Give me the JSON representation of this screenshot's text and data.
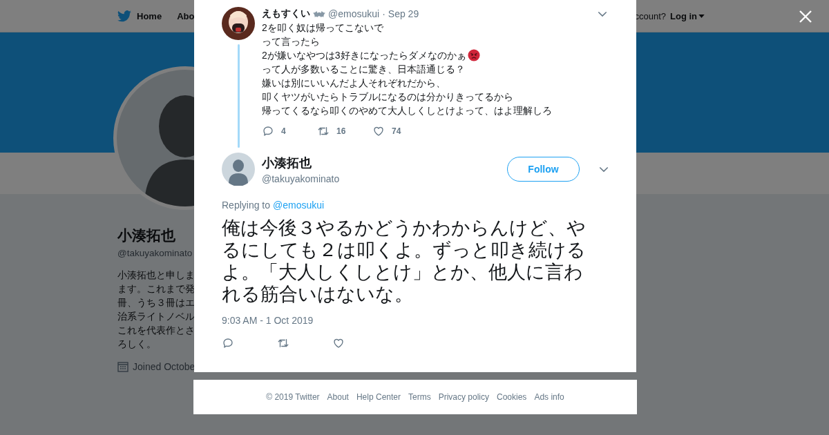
{
  "background_page": {
    "nav": {
      "items": [
        {
          "label": "Home"
        },
        {
          "label": "Abo"
        }
      ],
      "login_prompt": "ccount?",
      "login": "Log in"
    },
    "profile": {
      "name": "小湊拓也",
      "handle": "@takuyakominato",
      "bio_lines": [
        "小湊拓也と申しま",
        "ます。これまで発",
        "冊、うち３冊はエ",
        "治系ライトノベル",
        "これを代表作とさ",
        "ろしく。"
      ],
      "joined": "Joined Octobe"
    }
  },
  "modal": {
    "parent_tweet": {
      "name": "えもすくい",
      "handle": "@emosukui",
      "separator": "·",
      "date": "Sep 29",
      "lines": [
        {
          "text": "2を叩く奴は帰ってこないで",
          "emoji": false
        },
        {
          "text": "って言ったら",
          "emoji": false
        },
        {
          "text": "2が嫌いなやつは3好きになったらダメなのかぁ",
          "emoji": true
        },
        {
          "text": "って人が多数いることに驚き、日本語通じる？",
          "emoji": false
        },
        {
          "text": "嫌いは別にいいんだよ人それぞれだから、",
          "emoji": false
        },
        {
          "text": "叩くヤツがいたらトラブルになるのは分かりきってるから",
          "emoji": false
        },
        {
          "text": "帰ってくるなら叩くのやめて大人しくしとけよって、はよ理解しろ",
          "emoji": false
        }
      ],
      "replies": "4",
      "retweets": "16",
      "likes": "74"
    },
    "tweet": {
      "name": "小湊拓也",
      "handle": "@takuyakominato",
      "follow": "Follow",
      "replying_prefix": "Replying to",
      "replying_to": "@emosukui",
      "text": "俺は今後３やるかどうかわからんけど、やるにしても２は叩くよ。ずっと叩き続けるよ。「大人しくしとけ」とか、他人に言われる筋合いはないな。",
      "timestamp": "9:03 AM - 1 Oct 2019"
    }
  },
  "footer": {
    "links": [
      "© 2019 Twitter",
      "About",
      "Help Center",
      "Terms",
      "Privacy policy",
      "Cookies",
      "Ads info"
    ]
  }
}
